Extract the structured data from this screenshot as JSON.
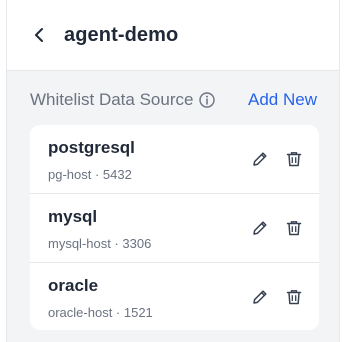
{
  "header": {
    "title": "agent-demo",
    "back_icon": "chevron-left-icon"
  },
  "section": {
    "title": "Whitelist Data Source",
    "info_icon": "info-circle-icon",
    "add_label": "Add New"
  },
  "sources": [
    {
      "name": "postgresql",
      "detail": "pg-host · 5432"
    },
    {
      "name": "mysql",
      "detail": "mysql-host · 3306"
    },
    {
      "name": "oracle",
      "detail": "oracle-host · 1521"
    }
  ],
  "colors": {
    "accent": "#2563eb",
    "text": "#1f2937",
    "muted": "#6b7280",
    "background": "#f3f4f6"
  }
}
